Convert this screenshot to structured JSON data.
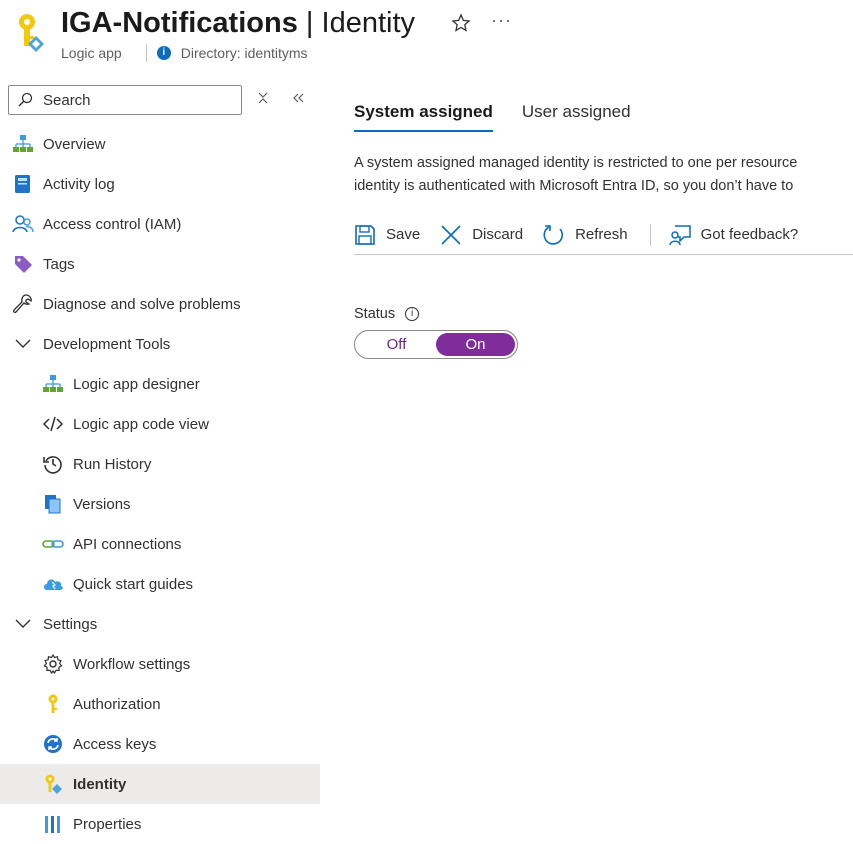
{
  "header": {
    "resource_name": "IGA-Notifications",
    "separator": "|",
    "page_name": "Identity",
    "resource_type": "Logic app",
    "directory": "Directory: identityms",
    "more_label": "···"
  },
  "search": {
    "placeholder": "Search"
  },
  "sidebar": {
    "items": [
      {
        "label": "Overview",
        "icon": "overview-icon",
        "level": 0
      },
      {
        "label": "Activity log",
        "icon": "activity-log-icon",
        "level": 0
      },
      {
        "label": "Access control (IAM)",
        "icon": "access-control-icon",
        "level": 0
      },
      {
        "label": "Tags",
        "icon": "tag-icon",
        "level": 0
      },
      {
        "label": "Diagnose and solve problems",
        "icon": "wrench-icon",
        "level": 0
      },
      {
        "label": "Development Tools",
        "icon": "chevron-down-icon",
        "level": 0,
        "group": true
      },
      {
        "label": "Logic app designer",
        "icon": "designer-icon",
        "level": 1
      },
      {
        "label": "Logic app code view",
        "icon": "code-icon",
        "level": 1
      },
      {
        "label": "Run History",
        "icon": "history-icon",
        "level": 1
      },
      {
        "label": "Versions",
        "icon": "versions-icon",
        "level": 1
      },
      {
        "label": "API connections",
        "icon": "link-icon",
        "level": 1
      },
      {
        "label": "Quick start guides",
        "icon": "cloud-icon",
        "level": 1
      },
      {
        "label": "Settings",
        "icon": "chevron-down-icon",
        "level": 0,
        "group": true
      },
      {
        "label": "Workflow settings",
        "icon": "gear-icon",
        "level": 1
      },
      {
        "label": "Authorization",
        "icon": "key-icon",
        "level": 1
      },
      {
        "label": "Access keys",
        "icon": "refresh-key-icon",
        "level": 1
      },
      {
        "label": "Identity",
        "icon": "identity-icon",
        "level": 1,
        "selected": true
      },
      {
        "label": "Properties",
        "icon": "properties-icon",
        "level": 1
      }
    ]
  },
  "tabs": [
    {
      "label": "System assigned",
      "active": true
    },
    {
      "label": "User assigned",
      "active": false
    }
  ],
  "description": {
    "line1": "A system assigned managed identity is restricted to one per resource",
    "line2": "identity is authenticated with Microsoft Entra ID, so you don’t have to"
  },
  "toolbar": {
    "save": "Save",
    "discard": "Discard",
    "refresh": "Refresh",
    "feedback": "Got feedback?"
  },
  "status": {
    "label": "Status",
    "off": "Off",
    "on": "On",
    "value": "On"
  },
  "colors": {
    "accent": "#0f6cbd",
    "toggle_on": "#7e2d9b",
    "selected_bg": "#edebe9"
  }
}
